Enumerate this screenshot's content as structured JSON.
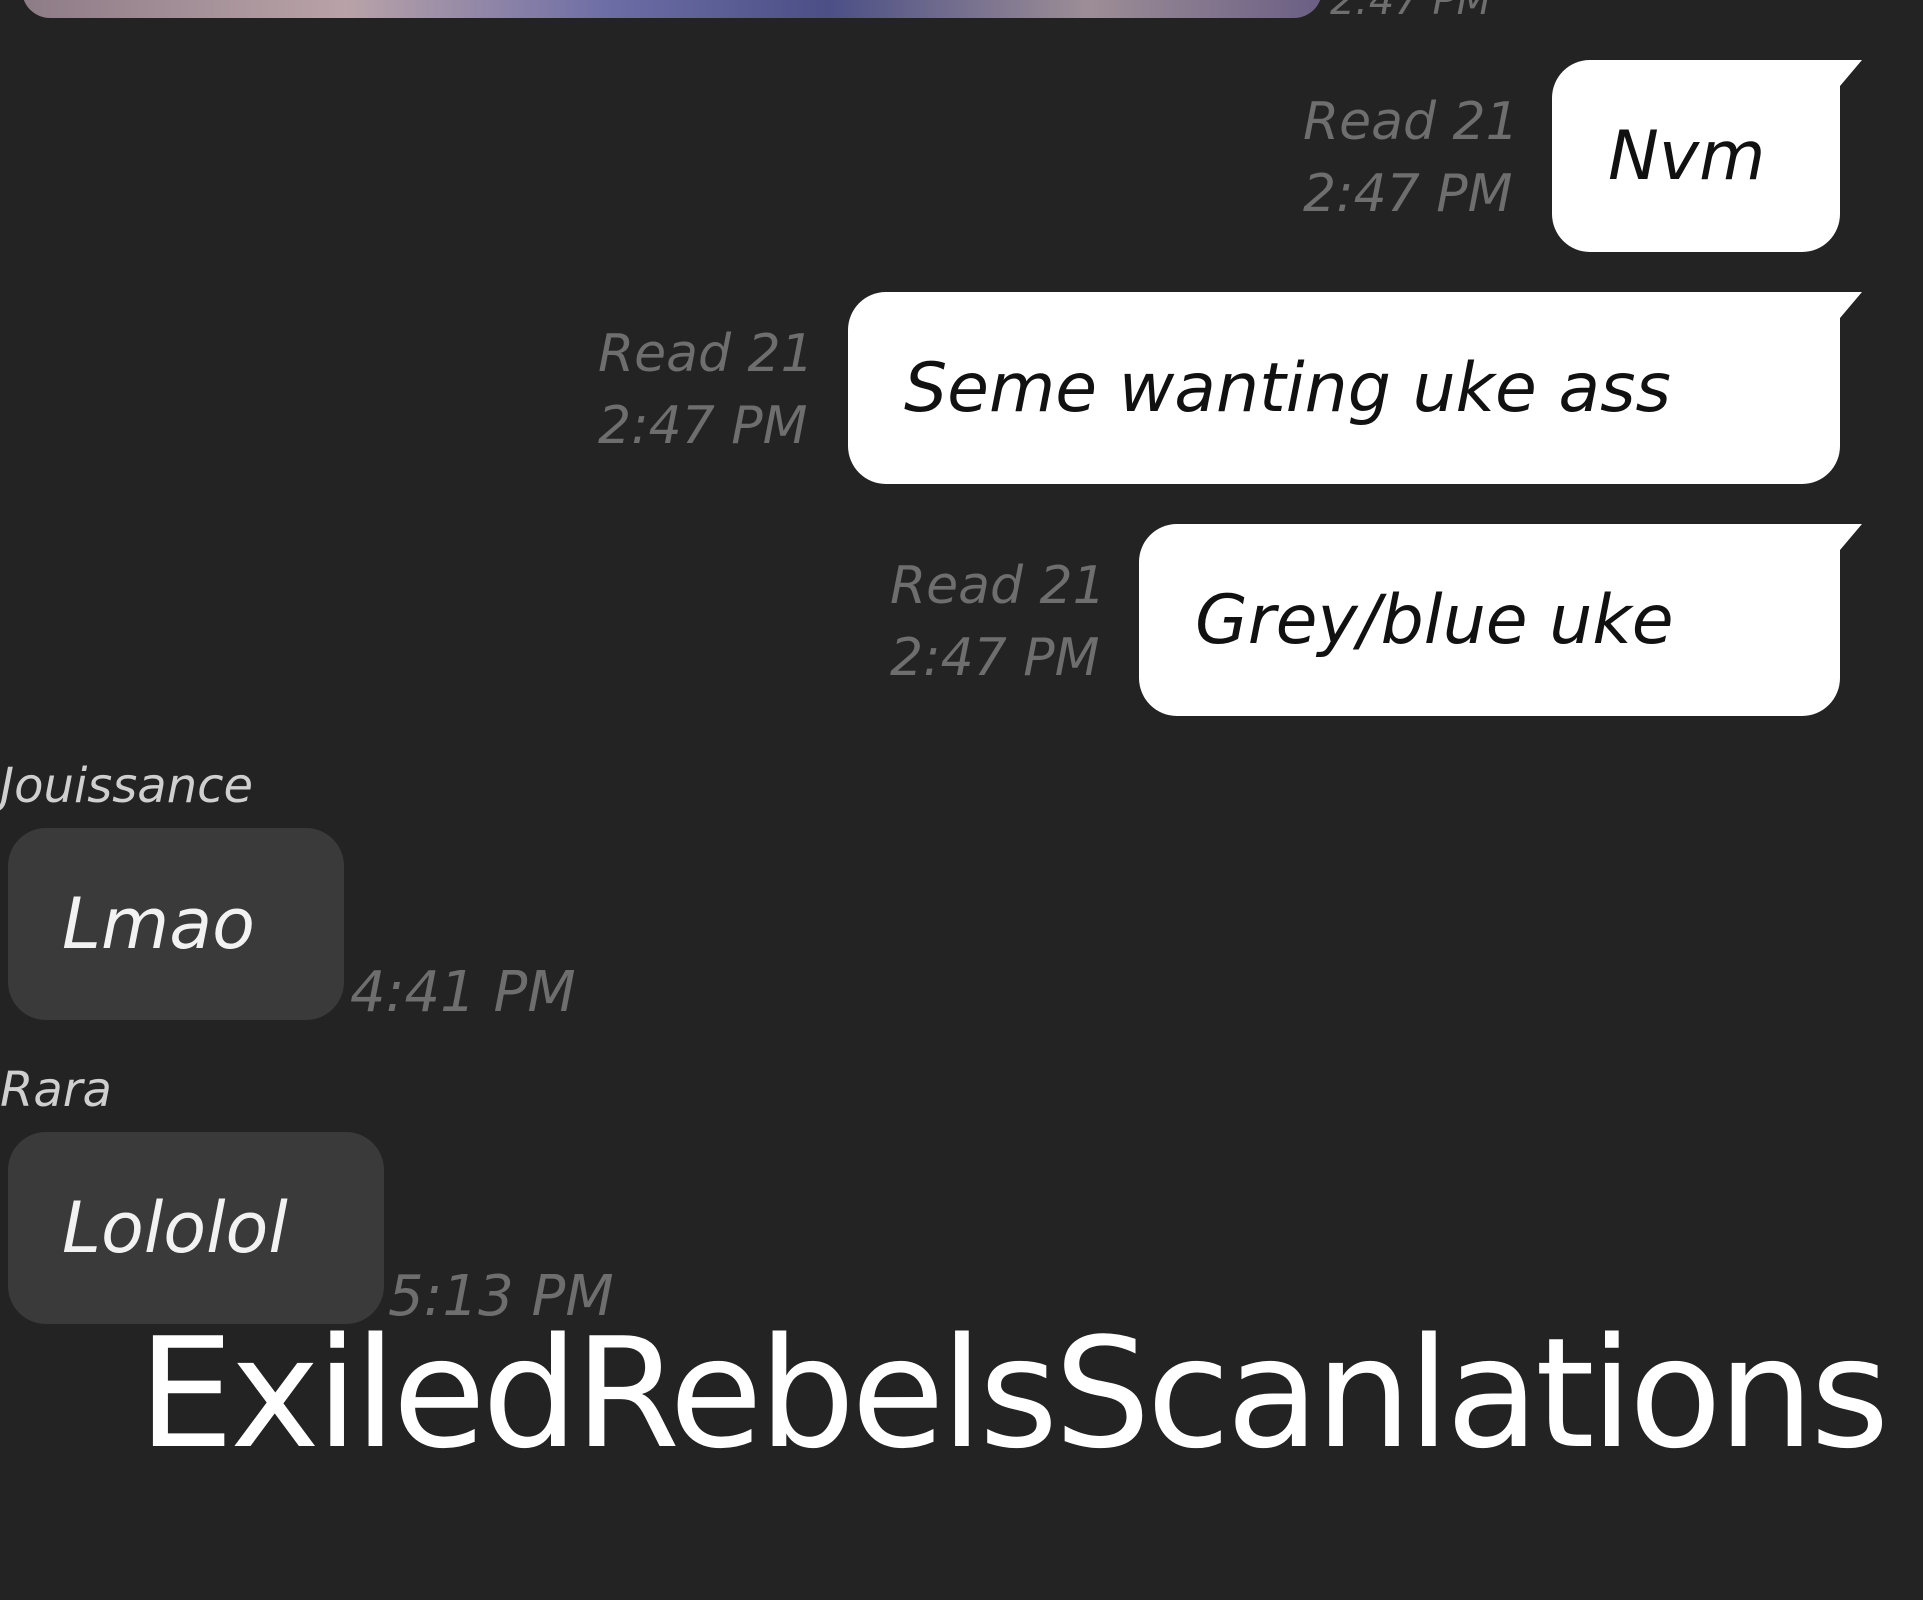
{
  "top_message": {
    "time": "2:47 PM"
  },
  "outgoing": [
    {
      "text": "Nvm",
      "status": "Read 21",
      "time": "2:47 PM"
    },
    {
      "text": "Seme wanting uke ass",
      "status": "Read 21",
      "time": "2:47 PM"
    },
    {
      "text": "Grey/blue uke",
      "status": "Read 21",
      "time": "2:47 PM"
    }
  ],
  "incoming": [
    {
      "sender": "Jouissance",
      "text": "Lmao",
      "time": "4:41 PM"
    },
    {
      "sender": "Rara",
      "text": "Lololol",
      "time": "5:13 PM"
    }
  ],
  "watermark": "ExiledRebelsScanlations",
  "colors": {
    "background": "#232323",
    "outgoing_bubble": "#ffffff",
    "incoming_bubble": "#3a3a3a",
    "meta_text": "#6e6e6e"
  }
}
